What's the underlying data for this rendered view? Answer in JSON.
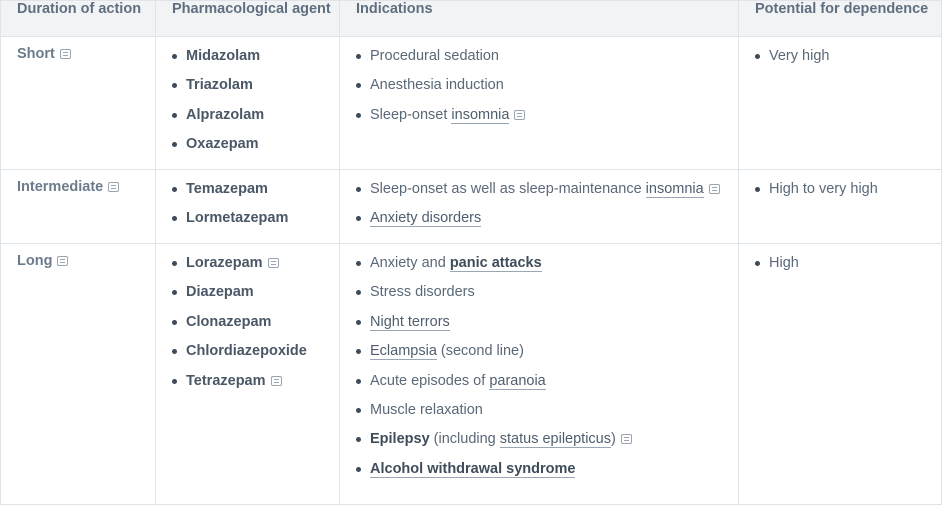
{
  "headers": [
    "Duration of action",
    "Pharmacological agent",
    "Indications",
    "Potential for dependence"
  ],
  "rows": [
    {
      "duration": "Short",
      "agents": [
        "Midazolam",
        "Triazolam",
        "Alprazolam",
        "Oxazepam"
      ],
      "indications": {
        "i0": "Procedural sedation",
        "i1": "Anesthesia induction",
        "i2_pre": "Sleep-onset ",
        "i2_link": "insomnia"
      },
      "dependence": "Very high"
    },
    {
      "duration": "Intermediate",
      "agents": [
        "Temazepam",
        "Lormetazepam"
      ],
      "indications": {
        "i0_pre": "Sleep-onset as well as sleep-maintenance ",
        "i0_link": "insomnia",
        "i1_link": "Anxiety disorders"
      },
      "dependence": "High to very high"
    },
    {
      "duration": "Long",
      "agents": [
        "Lorazepam",
        "Diazepam",
        "Clonazepam",
        "Chlordiazepoxide",
        "Tetrazepam"
      ],
      "indications": {
        "i0_pre": "Anxiety and ",
        "i0_link": "panic attacks",
        "i1": "Stress disorders",
        "i2_link": "Night terrors",
        "i3_link": "Eclampsia",
        "i3_post": " (second line)",
        "i4_pre": "Acute episodes of ",
        "i4_link": "paranoia",
        "i5": "Muscle relaxation",
        "i6_bold": "Epilepsy",
        "i6_mid": " (including ",
        "i6_link": "status epilepticus",
        "i6_post": ")",
        "i7_link": "Alcohol withdrawal syndrome"
      },
      "dependence": "High"
    }
  ]
}
